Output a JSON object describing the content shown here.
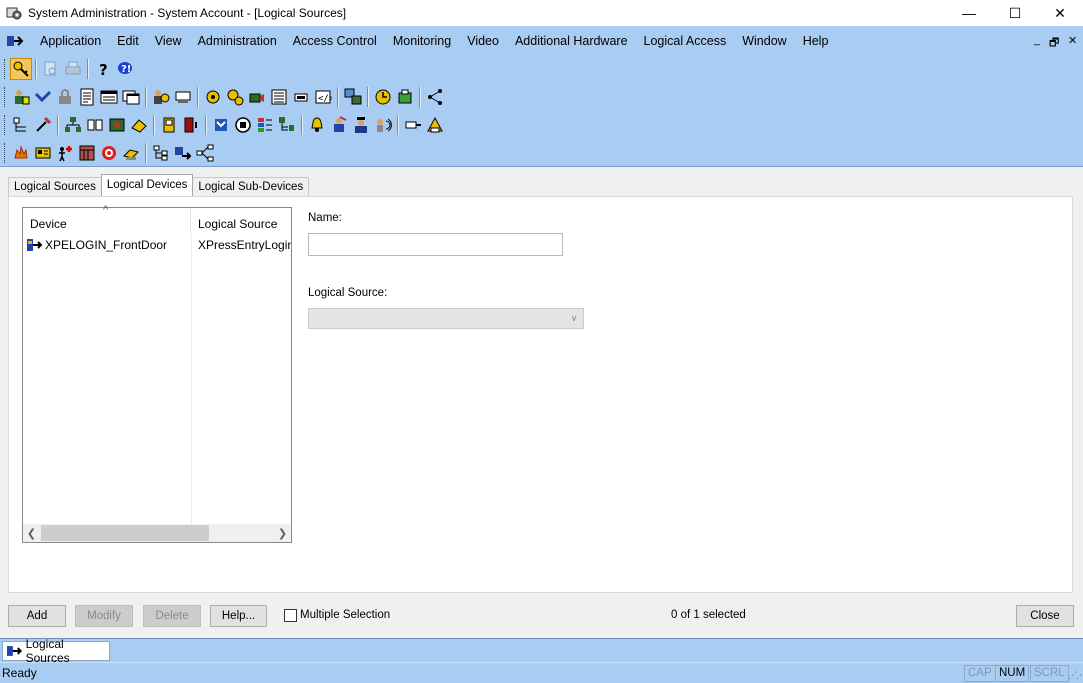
{
  "window": {
    "title": "System Administration - System Account - [Logical Sources]",
    "controls": {
      "minimize": "—",
      "maximize": "☐",
      "close": "✕"
    }
  },
  "menubar": {
    "items": [
      "Application",
      "Edit",
      "View",
      "Administration",
      "Access Control",
      "Monitoring",
      "Video",
      "Additional Hardware",
      "Logical Access",
      "Window",
      "Help"
    ],
    "mdi_controls": {
      "minimize": "_",
      "restore": "🗗",
      "close": "✕"
    }
  },
  "toolbars": {
    "row1": [
      "keys-icon",
      "print-preview-icon",
      "print-icon",
      "help-icon",
      "whats-this-icon"
    ],
    "row2": [
      "cardholders-icon",
      "badges-icon",
      "access-levels-icon",
      "reports-icon",
      "system-options-icon",
      "workstations-icon",
      "users-icon",
      "hardware-icon",
      "alarm-config-icon",
      "system-settings-icon",
      "digital-video-icon",
      "readers-icon",
      "panels-icon",
      "cameras-icon",
      "network-icon",
      "clock-icon",
      "devices-icon",
      "topology-icon"
    ],
    "row3": [
      "areas-icon",
      "tools-icon",
      "lists-icon",
      "cards-icon",
      "id-icon",
      "entry-icon",
      "doors-icon",
      "biometric-icon",
      "monitor-icon",
      "maps-icon",
      "zones-icon",
      "alarms-icon",
      "guard-icon",
      "officer-icon",
      "visitor-icon",
      "signal-icon",
      "reader-alert-icon"
    ],
    "row4": [
      "fire-icon",
      "intrusion-icon",
      "person-alert-icon",
      "panel-grid-icon",
      "target-icon",
      "badge-print-icon",
      "hierarchy-icon",
      "transfer-icon",
      "network-topology-icon"
    ]
  },
  "tabs": {
    "items": [
      "Logical Sources",
      "Logical Devices",
      "Logical Sub-Devices"
    ],
    "active_index": 1
  },
  "listview": {
    "columns": [
      "Device",
      "Logical Source"
    ],
    "rows": [
      {
        "device": "XPELOGIN_FrontDoor",
        "source": "XPressEntryLogin"
      }
    ]
  },
  "form": {
    "name_label": "Name:",
    "name_value": "",
    "logical_source_label": "Logical Source:",
    "logical_source_value": ""
  },
  "buttons": {
    "add": "Add",
    "modify": "Modify",
    "delete": "Delete",
    "help": "Help...",
    "close": "Close"
  },
  "multiple_selection_label": "Multiple Selection",
  "selection_status": "0 of 1 selected",
  "window_tab": "Logical Sources",
  "statusbar": {
    "text": "Ready",
    "cap": "CAP",
    "num": "NUM",
    "scrl": "SCRL"
  },
  "colors": {
    "frame_blue": "#a9cdf2",
    "active_toolbar_button": "#f6c65b"
  }
}
